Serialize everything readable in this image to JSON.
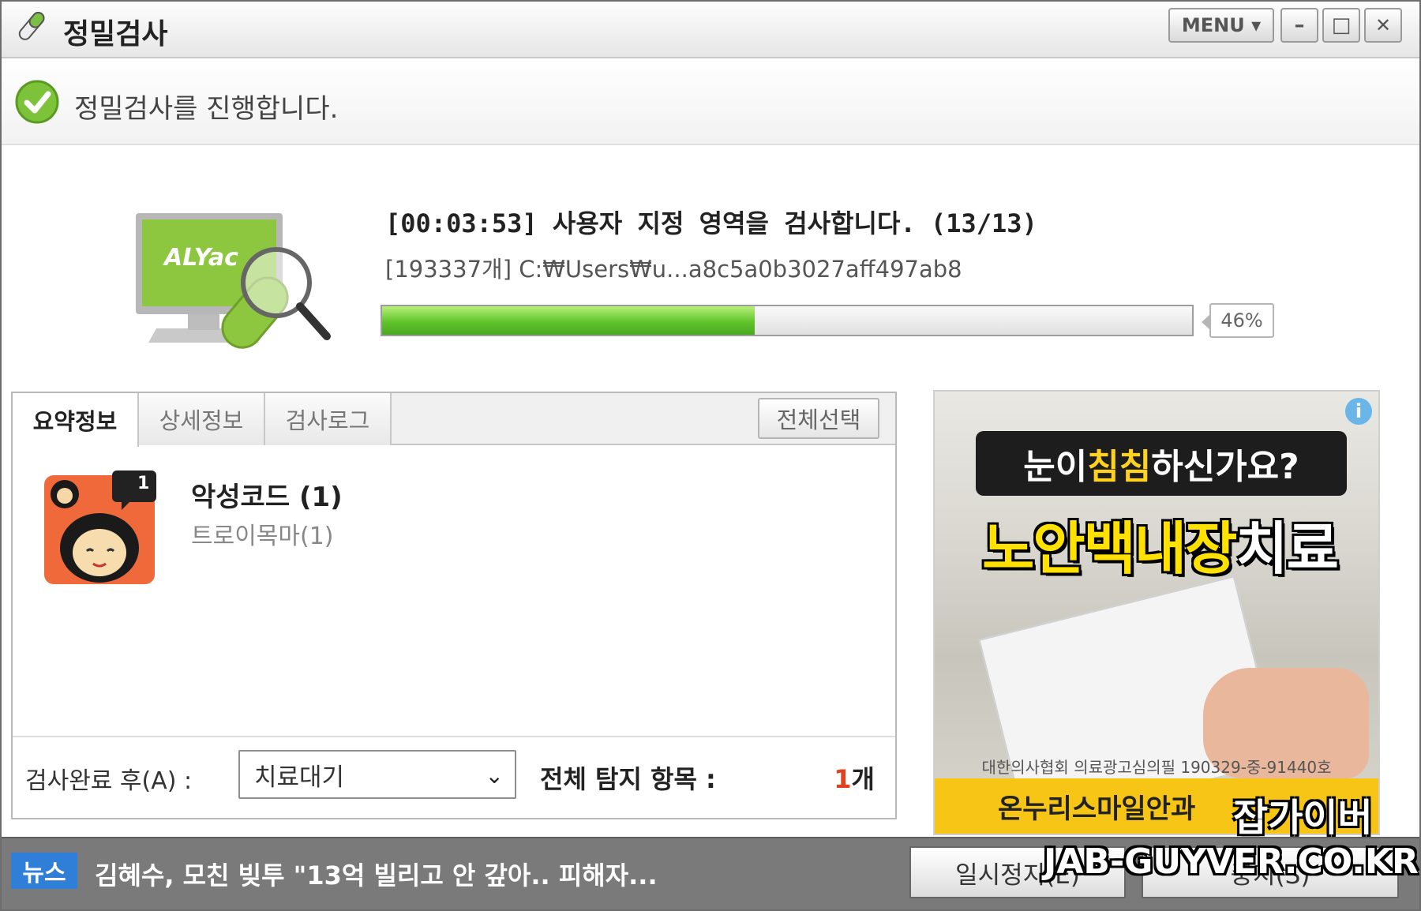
{
  "window": {
    "title": "정밀검사",
    "menu_label": "MENU ▾",
    "minimize_label": "–",
    "maximize_label": "□",
    "close_label": "✕"
  },
  "status": {
    "message": "정밀검사를 진행합니다."
  },
  "scan": {
    "title": "[00:03:53] 사용자 지정 영역을 검사합니다. (13/13)",
    "path": "[193337개] C:₩Users₩u...a8c5a0b3027aff497ab8",
    "progress": 46,
    "progress_label": "46%",
    "illustration_text": "ALYac"
  },
  "tabs": [
    {
      "label": "요약정보",
      "active": true
    },
    {
      "label": "상세정보",
      "active": false
    },
    {
      "label": "검사로그",
      "active": false
    }
  ],
  "select_all_label": "전체선택",
  "summary": {
    "badge": "1",
    "title": "악성코드 (1)",
    "subtitle": "트로이목마(1)"
  },
  "footer": {
    "after_label": "검사완료 후(A) :",
    "after_value": "치료대기",
    "total_label": "전체 탐지 항목 :",
    "total_num": "1",
    "total_unit": "개"
  },
  "ad": {
    "q_pre": "눈이 ",
    "q_hl": "침침",
    "q_post": "하신가요?",
    "headline_main": "노안백내장",
    "headline_tail": "치료",
    "license": "대한의사협회 의료광고심의필 190329-중-91440호",
    "brand": "온누리스마일안과"
  },
  "watermark": {
    "line1": "잡가이버",
    "line2": "JAB-GUYVER.CO.KR"
  },
  "bottom": {
    "news_badge": "뉴스",
    "news_text": "김혜수, 모친 빚투 \"13억 빌리고 안 갚아.. 피해자...",
    "pause_label": "일시정지(E)",
    "stop_label": "중지(S)"
  },
  "colors": {
    "progress_green": "#5fc42c",
    "news_blue": "#2f7fd8",
    "count_red": "#e3411b",
    "ad_yellow": "#ffe100"
  }
}
